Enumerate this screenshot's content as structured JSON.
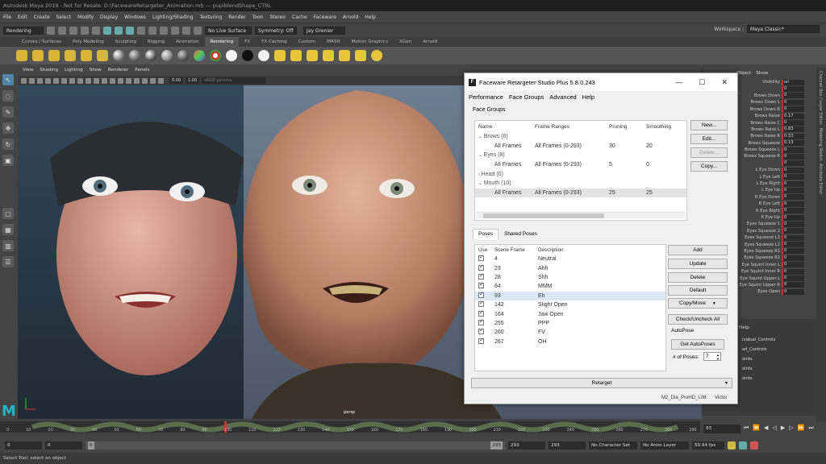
{
  "app": {
    "title": "Autodesk Maya 2019 - Not for Resale: D:\\FacewareRetargeter_Animation.mb  ---  pupiblendShape_CTRL",
    "menus": [
      "File",
      "Edit",
      "Create",
      "Select",
      "Modify",
      "Display",
      "Windows",
      "Lighting/Shading",
      "Texturing",
      "Render",
      "Toon",
      "Stereo",
      "Cache",
      "Faceware",
      "Arnold",
      "Help"
    ],
    "workspace_label": "Workspace :",
    "workspace_value": "Maya Classic*"
  },
  "statusline": {
    "mode": "Rendering",
    "live_surface": "No Live Surface",
    "symmetry": "Symmetry: Off",
    "user": "Jay Grenier"
  },
  "shelf_tabs": [
    "Curves / Surfaces",
    "Poly Modeling",
    "Sculpting",
    "Rigging",
    "Animation",
    "Rendering",
    "FX",
    "FX Caching",
    "Custom",
    "MASH",
    "Motion Graphics",
    "XGen",
    "Arnold"
  ],
  "shelf_active": "Rendering",
  "viewport": {
    "menus": [
      "View",
      "Shading",
      "Lighting",
      "Show",
      "Renderer",
      "Panels"
    ],
    "val_a": "0.00",
    "val_b": "1.00",
    "colorspace": "sRGB gamma",
    "camera": "persp"
  },
  "channelbox": {
    "headers": [
      "Object",
      "Show"
    ],
    "object": "CTRL",
    "rows": [
      {
        "name": "Visibility",
        "value": "on"
      },
      {
        "name": "",
        "value": "0"
      },
      {
        "name": "Brows Down",
        "value": "0"
      },
      {
        "name": "Brows Down L",
        "value": "0"
      },
      {
        "name": "Brows Down R",
        "value": "0"
      },
      {
        "name": "Brows Raise",
        "value": "0.17"
      },
      {
        "name": "Brows Raise C",
        "value": "0"
      },
      {
        "name": "Brows Raise L",
        "value": "0.83"
      },
      {
        "name": "Brows Raise R",
        "value": "0.53"
      },
      {
        "name": "Brows Squeeze",
        "value": "0.13"
      },
      {
        "name": "Brows Squeeze L",
        "value": "0"
      },
      {
        "name": "Brows Squeeze R",
        "value": "0"
      },
      {
        "name": "",
        "value": "0"
      },
      {
        "name": "L Eye Down",
        "value": "0"
      },
      {
        "name": "L Eye Left",
        "value": "0"
      },
      {
        "name": "L Eye Right",
        "value": "0"
      },
      {
        "name": "L Eye Up",
        "value": "0"
      },
      {
        "name": "R Eye Down",
        "value": "0"
      },
      {
        "name": "R Eye Left",
        "value": "0"
      },
      {
        "name": "R Eye Right",
        "value": "0"
      },
      {
        "name": "R Eye Up",
        "value": "0"
      },
      {
        "name": "Eyes Squeeze 1",
        "value": "0"
      },
      {
        "name": "Eyes Squeeze 2",
        "value": "0"
      },
      {
        "name": "Eyes Squeeze L1",
        "value": "0"
      },
      {
        "name": "Eyes Squeeze L2",
        "value": "0"
      },
      {
        "name": "Eyes Squeeze R1",
        "value": "0"
      },
      {
        "name": "Eyes Squeeze R2",
        "value": "0"
      },
      {
        "name": "Eye Squint Inner L",
        "value": "0"
      },
      {
        "name": "Eye Squint Inner R",
        "value": "0"
      },
      {
        "name": "Eye Squint Upper L",
        "value": "0"
      },
      {
        "name": "Eye Squint Upper R",
        "value": "0"
      },
      {
        "name": "Eyes Open",
        "value": "0"
      }
    ],
    "side_tabs": [
      "Channel Box / Layer Editor",
      "Modeling Toolkit",
      "Attribute Editor"
    ]
  },
  "layers": {
    "help": "Help",
    "items": [
      "ividual_Controls",
      "ad_Controls",
      "oints",
      "oints",
      "oints"
    ]
  },
  "timeline": {
    "ticks": [
      "0",
      "10",
      "20",
      "30",
      "40",
      "50",
      "60",
      "70",
      "80",
      "90",
      "100",
      "110",
      "120",
      "130",
      "140",
      "150",
      "160",
      "170",
      "180",
      "190",
      "200",
      "210",
      "220",
      "230",
      "240",
      "250",
      "260",
      "270",
      "280",
      "290"
    ],
    "playhead_label": "93",
    "current_frame": "93"
  },
  "rangebar": {
    "start": "0",
    "range_start": "0",
    "range_field": "0",
    "range_end_inner": "293",
    "range_end": "293",
    "end": "293",
    "character_set": "No Character Set",
    "anim_layer": "No Anim Layer",
    "fps": "59.94 fps"
  },
  "helpline": "Select Tool: select an object",
  "faceware": {
    "title": "Faceware Retargeter Studio Plus 5.8.0.243",
    "menus": [
      "Performance",
      "Face Groups",
      "Advanced",
      "Help"
    ],
    "face_groups_label": "Face Groups",
    "fg_headers": [
      "Name",
      "Frame Ranges",
      "Pruning",
      "Smoothing"
    ],
    "fg_rows": [
      {
        "name": "Brows (6)",
        "range": "",
        "pruning": "",
        "smoothing": "",
        "group": true,
        "expanded": true
      },
      {
        "name": "All Frames",
        "range": "All Frames (0-293)",
        "pruning": "30",
        "smoothing": "20",
        "group": false
      },
      {
        "name": "Eyes (8)",
        "range": "",
        "pruning": "",
        "smoothing": "",
        "group": true,
        "expanded": true
      },
      {
        "name": "All Frames",
        "range": "All Frames (0-293)",
        "pruning": "5",
        "smoothing": "0",
        "group": false
      },
      {
        "name": "Head (0)",
        "range": "",
        "pruning": "",
        "smoothing": "",
        "group": true,
        "expanded": false
      },
      {
        "name": "Mouth (10)",
        "range": "",
        "pruning": "",
        "smoothing": "",
        "group": true,
        "expanded": true
      },
      {
        "name": "All Frames",
        "range": "All Frames (0-293)",
        "pruning": "25",
        "smoothing": "25",
        "group": false,
        "selected": true
      }
    ],
    "fg_buttons": [
      "New...",
      "Edit...",
      "Delete...",
      "Copy..."
    ],
    "pose_tabs": [
      "Poses",
      "Shared Poses"
    ],
    "pose_headers": [
      "Use",
      "Scene Frame",
      "Description"
    ],
    "poses": [
      {
        "frame": "4",
        "desc": "Neutral"
      },
      {
        "frame": "23",
        "desc": "Ahh"
      },
      {
        "frame": "28",
        "desc": "Shh"
      },
      {
        "frame": "64",
        "desc": "MMM"
      },
      {
        "frame": "93",
        "desc": "Eh",
        "selected": true
      },
      {
        "frame": "142",
        "desc": "Slight Open"
      },
      {
        "frame": "164",
        "desc": "Jaw Open"
      },
      {
        "frame": "255",
        "desc": "PPP"
      },
      {
        "frame": "260",
        "desc": "FV"
      },
      {
        "frame": "267",
        "desc": "OH"
      }
    ],
    "pose_buttons": [
      "Add",
      "Update",
      "Delete",
      "Default",
      "Copy/Move",
      "Check/Uncheck All"
    ],
    "autopose_label": "AutoPose",
    "get_autoposes": "Get AutoPoses",
    "num_poses_label": "# of Poses:",
    "num_poses_value": "7",
    "retarget": "Retarget",
    "footer_file": "M2_Dia_ProHD_L08",
    "footer_user": "Victor"
  }
}
